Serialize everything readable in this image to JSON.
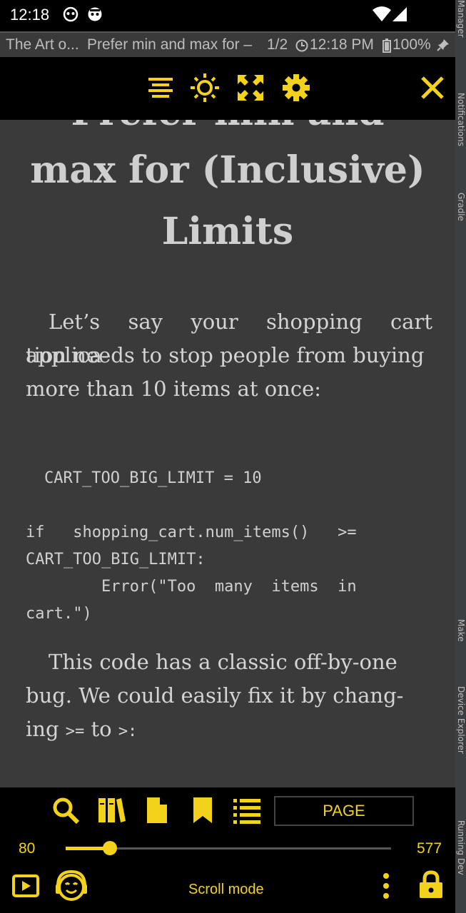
{
  "status": {
    "time": "12:18"
  },
  "infobar": {
    "book_title": "The Art o...",
    "chapter": "Prefer min and max for –",
    "page": "1/2",
    "clock": "12:18 PM",
    "battery": "100%"
  },
  "toolbar": {
    "icons": [
      "align-icon",
      "brightness-icon",
      "fullscreen-icon",
      "settings-icon",
      "close-icon"
    ]
  },
  "content": {
    "title_lines": [
      "Prefer min and",
      "max for (Inclusive)",
      "Limits"
    ],
    "para1_lines": [
      "Let’s say your shopping cart applica-",
      "tion needs to stop people from buying",
      "more than 10 items at once:"
    ],
    "code_line1": "CART_TOO_BIG_LIMIT = 10",
    "code_line2": "if   shopping_cart.num_items()   >=",
    "code_line3": "CART_TOO_BIG_LIMIT:",
    "code_line4": "        Error(\"Too  many  items  in",
    "code_line5": "cart.\")",
    "para2_lines": [
      "This code has a classic off-by-one",
      "bug. We could easily fix it by chang-"
    ],
    "para2_last": "ing",
    "para2_op1": ">=",
    "para2_to": "to",
    "para2_op2": ">:"
  },
  "bottom": {
    "page_button": "PAGE",
    "slider_min": "80",
    "slider_max": "577",
    "slider_fraction": 0.136,
    "scroll_mode": "Scroll mode"
  },
  "side_strip": {
    "labels": [
      "Manager",
      "Notifications",
      "Gradle",
      "Make",
      "Device Explorer",
      "Running Dev"
    ]
  },
  "colors": {
    "accent": "#f2d21a",
    "background": "#3a3a3a",
    "bar": "#000000"
  }
}
